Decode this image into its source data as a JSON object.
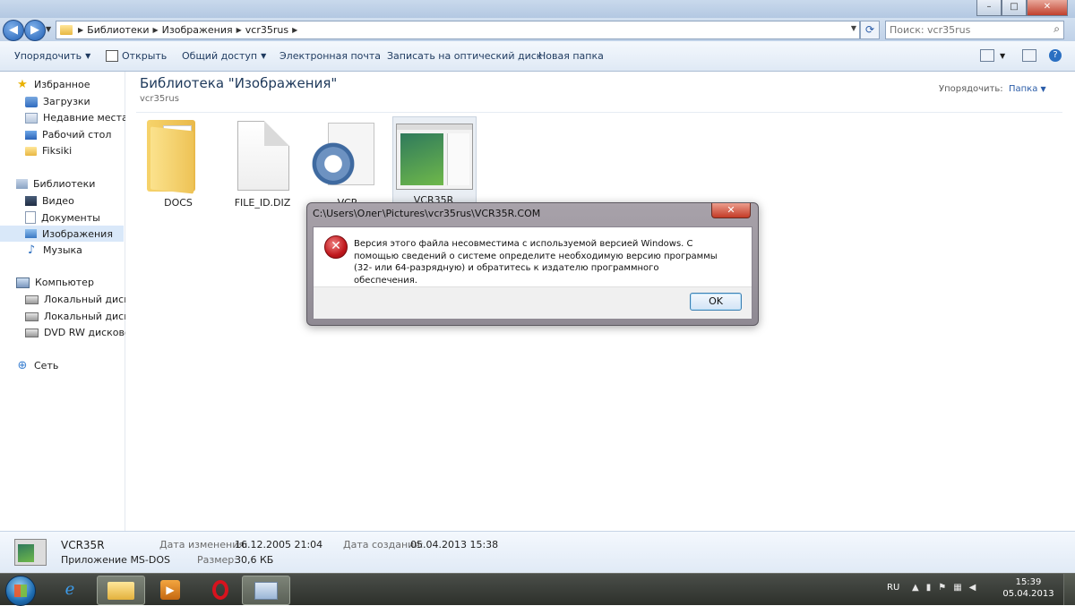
{
  "address": {
    "crumbs": [
      "Библиотеки",
      "Изображения",
      "vcr35rus"
    ],
    "search_placeholder": "Поиск: vcr35rus"
  },
  "toolbar": {
    "organize": "Упорядочить",
    "open": "Открыть",
    "share": "Общий доступ",
    "email": "Электронная почта",
    "burn": "Записать на оптический диск",
    "new_folder": "Новая папка"
  },
  "sidebar": {
    "favorites": "Избранное",
    "downloads": "Загрузки",
    "recent": "Недавние места",
    "desktop": "Рабочий стол",
    "fiksiki": "Fiksiki",
    "libraries": "Библиотеки",
    "video": "Видео",
    "documents": "Документы",
    "images": "Изображения",
    "music": "Музыка",
    "computer": "Компьютер",
    "disk_c": "Локальный диск (C",
    "disk_d": "Локальный диск (D",
    "dvd": "DVD RW дисковод (",
    "network": "Сеть"
  },
  "library": {
    "title": "Библиотека \"Изображения\"",
    "subtitle": "vcr35rus",
    "sort_label": "Упорядочить:",
    "sort_value": "Папка"
  },
  "files": {
    "docs": "DOCS",
    "file_id": "FILE_ID.DIZ",
    "vcr": "VCR",
    "vcr35r": "VCR35R"
  },
  "details": {
    "name": "VCR35R",
    "type": "Приложение MS-DOS",
    "modified_label": "Дата изменения:",
    "modified_value": "16.12.2005 21:04",
    "size_label": "Размер:",
    "size_value": "30,6 КБ",
    "created_label": "Дата создания:",
    "created_value": "05.04.2013 15:38"
  },
  "dialog": {
    "title": "C:\\Users\\Олег\\Pictures\\vcr35rus\\VCR35R.COM",
    "message": "Версия этого файла несовместима с используемой версией Windows. С помощью сведений о системе определите необходимую версию программы (32- или 64-разрядную) и обратитесь к издателю программного обеспечения.",
    "ok": "OK"
  },
  "taskbar": {
    "lang": "RU",
    "time": "15:39",
    "date": "05.04.2013"
  }
}
